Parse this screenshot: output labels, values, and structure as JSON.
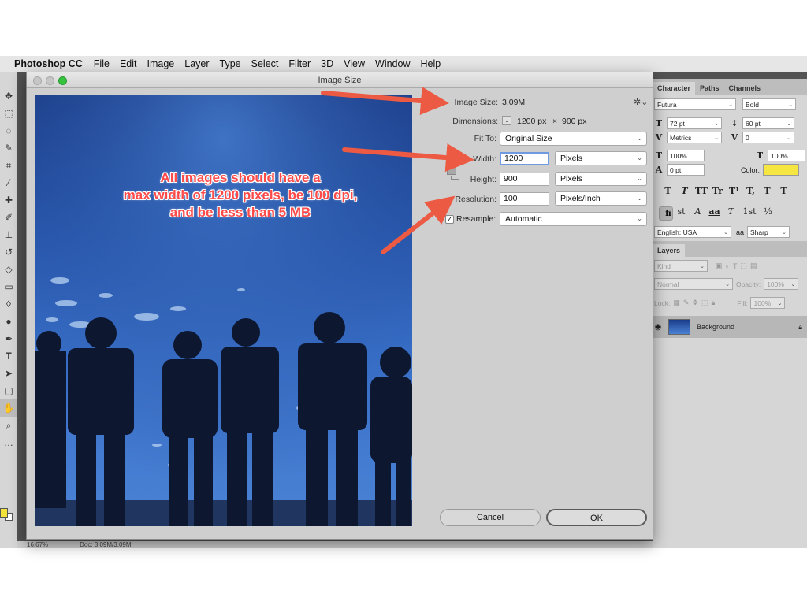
{
  "menubar": {
    "app_name": "Photoshop CC",
    "items": [
      "File",
      "Edit",
      "Image",
      "Layer",
      "Type",
      "Select",
      "Filter",
      "3D",
      "View",
      "Window",
      "Help"
    ]
  },
  "dialog": {
    "title": "Image Size",
    "image_size_label": "Image Size:",
    "image_size_value": "3.09M",
    "dimensions_label": "Dimensions:",
    "dimensions_width": "1200 px",
    "dimensions_times": "×",
    "dimensions_height": "900 px",
    "fit_to_label": "Fit To:",
    "fit_to_value": "Original Size",
    "width_label": "Width:",
    "width_value": "1200",
    "width_unit": "Pixels",
    "height_label": "Height:",
    "height_value": "900",
    "height_unit": "Pixels",
    "resolution_label": "Resolution:",
    "resolution_value": "100",
    "resolution_unit": "Pixels/Inch",
    "resample_label": "Resample:",
    "resample_checked": true,
    "resample_value": "Automatic",
    "cancel_label": "Cancel",
    "ok_label": "OK"
  },
  "annotation": {
    "line1": "All images should have a",
    "line2": "max width of 1200 pixels, be 100 dpi,",
    "line3": "and be less than 5 MB",
    "color": "#f0503c"
  },
  "panels": {
    "tabs": [
      "Character",
      "Paths",
      "Channels"
    ],
    "font_family": "Futura",
    "font_style": "Bold",
    "font_size": "72 pt",
    "leading": "60 pt",
    "kerning": "Metrics",
    "tracking": "0",
    "vertical_scale": "100%",
    "horizontal_scale": "100%",
    "baseline_shift": "0 pt",
    "color_label": "Color:",
    "text_color": "#f5e642",
    "type_buttons": [
      "T",
      "T",
      "TT",
      "Tr",
      "T¹",
      "T,",
      "T",
      "T"
    ],
    "opentype_buttons": [
      "fi",
      "ơ",
      "st",
      "A",
      "aa",
      "T",
      "1st",
      "½"
    ],
    "language": "English: USA",
    "aa_icon_label": "aa",
    "antialias": "Sharp",
    "layers_tab": "Layers",
    "kind_label": "Kind",
    "blend_mode": "Normal",
    "opacity_label": "Opacity:",
    "opacity_value": "100%",
    "lock_label": "Lock:",
    "fill_label": "Fill:",
    "fill_value": "100%",
    "layer_name": "Background"
  },
  "statusbar": {
    "zoom": "16.67%",
    "doc": "Doc: 3.09M/3.09M"
  }
}
